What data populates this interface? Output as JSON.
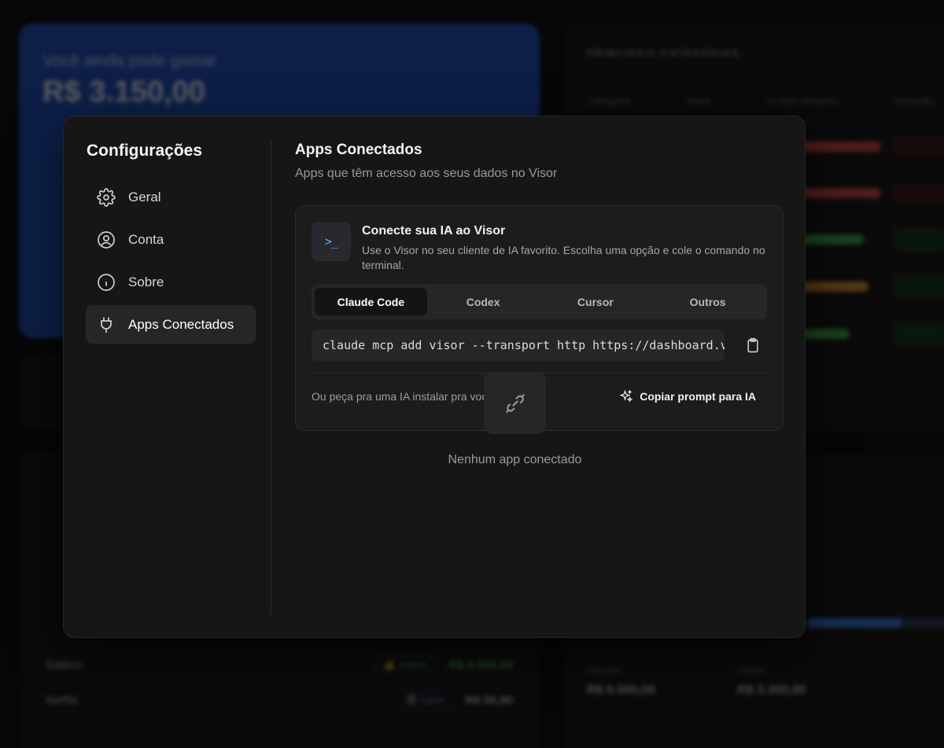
{
  "background": {
    "hero": {
      "line1": "Você ainda pode gastar",
      "line2": "R$ 3.150,00"
    },
    "categories": {
      "heading": "PRINCIPAIS CATEGORIAS",
      "columns": [
        "Categoria",
        "Atual",
        "vs Mês Anterior",
        "Variação"
      ]
    },
    "transactions": {
      "rows": [
        {
          "name": "Salário",
          "tag": "💰 Salário",
          "amount": "R$ 6.500,00"
        },
        {
          "name": "Netflix",
          "tag": "🎬 Lazer",
          "amount": "R$ 55,90"
        }
      ]
    },
    "summary": {
      "stats": [
        {
          "label": "Receita",
          "value": "R$ 6.500,00"
        },
        {
          "label": "Gasto",
          "value": "R$ 3.350,00"
        }
      ]
    }
  },
  "sidebar": {
    "title": "Configurações",
    "items": [
      {
        "label": "Geral",
        "icon": "gear-icon"
      },
      {
        "label": "Conta",
        "icon": "user-circle-icon"
      },
      {
        "label": "Sobre",
        "icon": "info-icon"
      },
      {
        "label": "Apps Conectados",
        "icon": "plug-icon",
        "active": true
      }
    ]
  },
  "main": {
    "title": "Apps Conectados",
    "subtitle": "Apps que têm acesso aos seus dados no Visor",
    "connect": {
      "icon_text": ">_",
      "title": "Conecte sua IA ao Visor",
      "description": "Use o Visor no seu cliente de IA favorito. Escolha uma opção e cole o comando no terminal.",
      "tabs": [
        "Claude Code",
        "Codex",
        "Cursor",
        "Outros"
      ],
      "active_tab": "Claude Code",
      "command": "claude mcp add visor --transport http https://dashboard.vi",
      "hint": "Ou peça pra uma IA instalar pra você",
      "prompt_button": "Copiar prompt para IA"
    },
    "empty_state": {
      "text": "Nenhum app conectado"
    }
  },
  "colors": {
    "modal_bg": "#161616",
    "card_bg": "#1c1c1c",
    "accent_blue": "#6ea6ff",
    "hero_blue": "#1f4fbf"
  }
}
